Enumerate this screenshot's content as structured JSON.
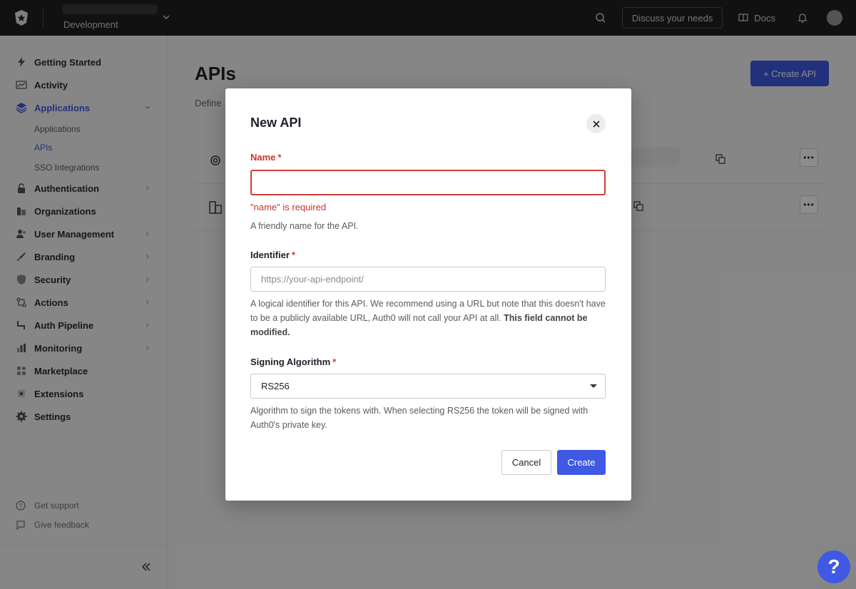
{
  "topbar": {
    "tenant_env": "Development",
    "discuss_label": "Discuss your needs",
    "docs_label": "Docs"
  },
  "sidebar": {
    "items": [
      {
        "label": "Getting Started",
        "icon": "lightning-icon"
      },
      {
        "label": "Activity",
        "icon": "activity-icon"
      },
      {
        "label": "Applications",
        "icon": "layers-icon"
      },
      {
        "label": "Authentication",
        "icon": "lock-icon"
      },
      {
        "label": "Organizations",
        "icon": "organization-icon"
      },
      {
        "label": "User Management",
        "icon": "users-icon"
      },
      {
        "label": "Branding",
        "icon": "brush-icon"
      },
      {
        "label": "Security",
        "icon": "shield-icon"
      },
      {
        "label": "Actions",
        "icon": "actions-icon"
      },
      {
        "label": "Auth Pipeline",
        "icon": "pipeline-icon"
      },
      {
        "label": "Monitoring",
        "icon": "bar-chart-icon"
      },
      {
        "label": "Marketplace",
        "icon": "marketplace-icon"
      },
      {
        "label": "Extensions",
        "icon": "extension-icon"
      },
      {
        "label": "Settings",
        "icon": "gear-icon"
      }
    ],
    "sub_items": [
      "Applications",
      "APIs",
      "SSO Integrations"
    ],
    "footer": {
      "support": "Get support",
      "feedback": "Give feedback"
    }
  },
  "main": {
    "title": "APIs",
    "description": "Define",
    "create_button": "+ Create API"
  },
  "modal": {
    "title": "New API",
    "name_label": "Name",
    "required_mark": "*",
    "name_value": "",
    "name_error": "\"name\" is required",
    "name_help": "A friendly name for the API.",
    "identifier_label": "Identifier",
    "identifier_placeholder": "https://your-api-endpoint/",
    "identifier_help": "A logical identifier for this API. We recommend using a URL but note that this doesn't have to be a publicly available URL, Auth0 will not call your API at all.",
    "identifier_help_bold": "This field cannot be modified.",
    "algorithm_label": "Signing Algorithm",
    "algorithm_value": "RS256",
    "algorithm_help": "Algorithm to sign the tokens with. When selecting RS256 the token will be signed with Auth0's private key.",
    "cancel_label": "Cancel",
    "create_label": "Create"
  },
  "help_fab": "?",
  "colors": {
    "accent": "#3f59e4",
    "error": "#d03c38",
    "topbar": "#1f1f22"
  }
}
